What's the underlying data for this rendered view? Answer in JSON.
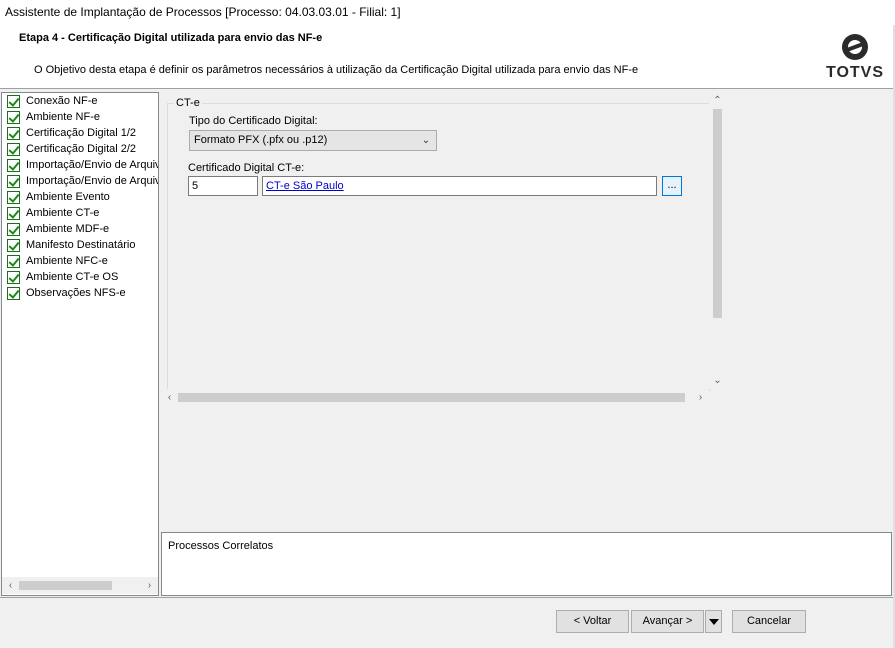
{
  "window": {
    "title": "Assistente de Implantação de Processos [Processo: 04.03.03.01 - Filial: 1]"
  },
  "header": {
    "step_title": "Etapa 4 - Certificação Digital utilizada para envio das NF-e",
    "description": "O Objetivo desta etapa é definir os parâmetros necessários à utilização da Certificação Digital utilizada para envio das NF-e",
    "logo_text": "TOTVS"
  },
  "sidebar": {
    "items": [
      {
        "label": "Conexão NF-e"
      },
      {
        "label": "Ambiente NF-e"
      },
      {
        "label": "Certificação Digital 1/2"
      },
      {
        "label": "Certificação Digital 2/2"
      },
      {
        "label": "Importação/Envio de Arquivo"
      },
      {
        "label": "Importação/Envio de Arquivo"
      },
      {
        "label": "Ambiente Evento"
      },
      {
        "label": "Ambiente CT-e"
      },
      {
        "label": "Ambiente MDF-e"
      },
      {
        "label": "Manifesto Destinatário"
      },
      {
        "label": "Ambiente NFC-e"
      },
      {
        "label": "Ambiente CT-e OS"
      },
      {
        "label": "Observações NFS-e"
      }
    ],
    "scroll_left": "‹",
    "scroll_right": "›"
  },
  "form": {
    "group_label": "CT-e",
    "cert_type_label": "Tipo do Certificado Digital:",
    "cert_type_value": "Formato PFX (.pfx ou .p12)",
    "cert_label": "Certificado Digital CT-e:",
    "cert_code": "5",
    "cert_name": "CT-e São Paulo",
    "browse_label": "..."
  },
  "related": {
    "title": "Processos Correlatos"
  },
  "buttons": {
    "back": "< Voltar",
    "next": "Avançar >",
    "cancel": "Cancelar"
  }
}
